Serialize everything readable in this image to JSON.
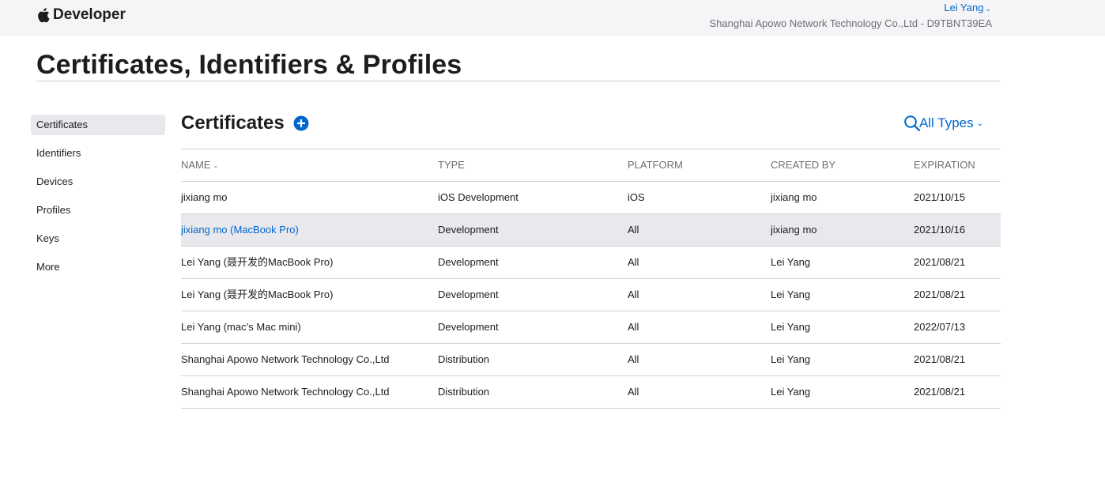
{
  "header": {
    "brand": "Developer",
    "user_name": "Lei Yang",
    "team": "Shanghai Apowo Network Technology Co.,Ltd - D9TBNT39EA"
  },
  "page_title": "Certificates, Identifiers & Profiles",
  "sidebar": {
    "items": [
      {
        "label": "Certificates",
        "active": true
      },
      {
        "label": "Identifiers"
      },
      {
        "label": "Devices"
      },
      {
        "label": "Profiles"
      },
      {
        "label": "Keys"
      },
      {
        "label": "More"
      }
    ]
  },
  "section": {
    "title": "Certificates",
    "filter_label": "All Types"
  },
  "table": {
    "columns": {
      "name": "NAME",
      "type": "TYPE",
      "platform": "PLATFORM",
      "created_by": "CREATED BY",
      "expiration": "EXPIRATION"
    },
    "rows": [
      {
        "name": "jixiang mo",
        "type": "iOS Development",
        "platform": "iOS",
        "created_by": "jixiang mo",
        "expiration": "2021/10/15"
      },
      {
        "name": "jixiang mo (MacBook Pro)",
        "type": "Development",
        "platform": "All",
        "created_by": "jixiang mo",
        "expiration": "2021/10/16",
        "selected": true
      },
      {
        "name": "Lei Yang (聂开发的MacBook Pro)",
        "type": "Development",
        "platform": "All",
        "created_by": "Lei Yang",
        "expiration": "2021/08/21"
      },
      {
        "name": "Lei Yang (聂开发的MacBook Pro)",
        "type": "Development",
        "platform": "All",
        "created_by": "Lei Yang",
        "expiration": "2021/08/21"
      },
      {
        "name": "Lei Yang (mac’s Mac mini)",
        "type": "Development",
        "platform": "All",
        "created_by": "Lei Yang",
        "expiration": "2022/07/13"
      },
      {
        "name": "Shanghai Apowo Network Technology Co.,Ltd",
        "type": "Distribution",
        "platform": "All",
        "created_by": "Lei Yang",
        "expiration": "2021/08/21"
      },
      {
        "name": "Shanghai Apowo Network Technology Co.,Ltd",
        "type": "Distribution",
        "platform": "All",
        "created_by": "Lei Yang",
        "expiration": "2021/08/21"
      }
    ]
  },
  "colors": {
    "accent": "#0066cc",
    "header_bg": "#f5f5f7",
    "selected_row": "#e8e8ed"
  },
  "icons": [
    "apple-logo-icon",
    "chevron-down-icon",
    "add-circle-icon",
    "search-icon"
  ]
}
